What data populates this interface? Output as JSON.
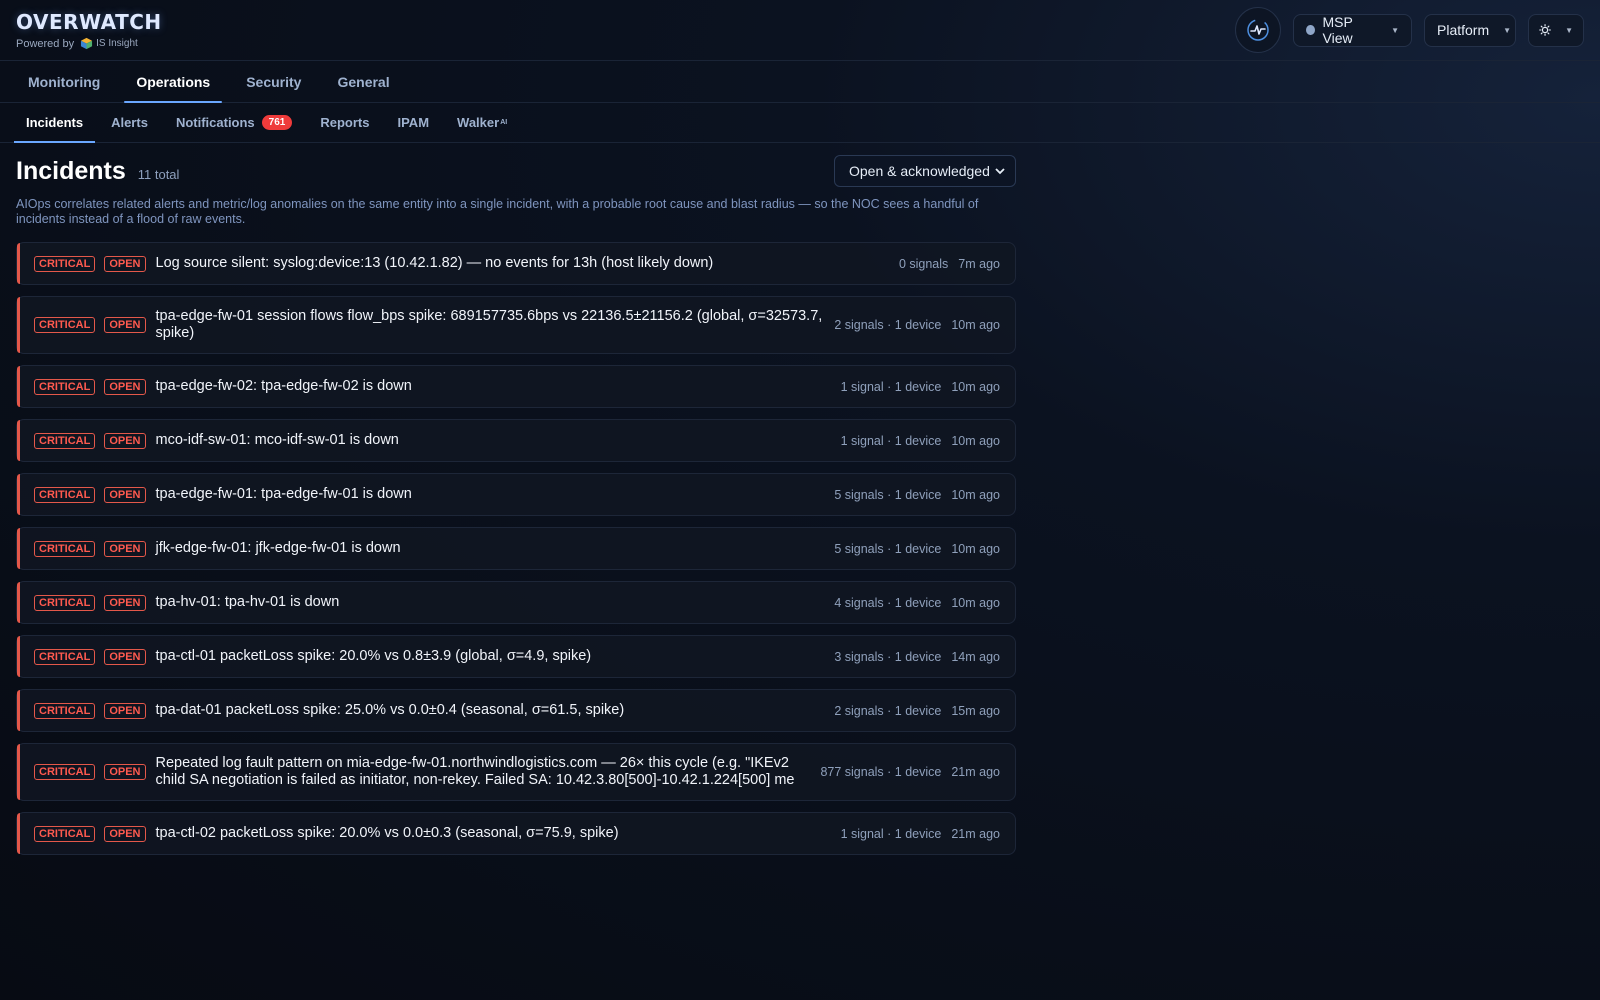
{
  "brand": {
    "title": "OVERWATCH",
    "powered_by": "Powered by",
    "logo_text": "IS Insight"
  },
  "header": {
    "msp_view": "MSP View",
    "platform": "Platform"
  },
  "main_tabs": [
    "Monitoring",
    "Operations",
    "Security",
    "General"
  ],
  "sub_tabs": {
    "incidents": "Incidents",
    "alerts": "Alerts",
    "notifications": "Notifications",
    "notifications_count": "761",
    "reports": "Reports",
    "ipam": "IPAM",
    "walker": "Walker",
    "walker_sup": "AI"
  },
  "page": {
    "title": "Incidents",
    "total": "11 total",
    "filter": "Open & acknowledged",
    "description": "AIOps correlates related alerts and metric/log anomalies on the same entity into a single incident, with a probable root cause and blast radius — so the NOC sees a handful of incidents instead of a flood of raw events."
  },
  "incidents": [
    {
      "severity": "CRITICAL",
      "status": "OPEN",
      "title": "Log source silent: syslog:device:13 (10.42.1.82) — no events for 13h (host likely down)",
      "meta": "0 signals",
      "ago": "7m ago"
    },
    {
      "severity": "CRITICAL",
      "status": "OPEN",
      "title": "tpa-edge-fw-01 session flows flow_bps spike: 689157735.6bps vs 22136.5±21156.2 (global, σ=32573.7, spike)",
      "meta": "2 signals · 1 device",
      "ago": "10m ago"
    },
    {
      "severity": "CRITICAL",
      "status": "OPEN",
      "title": "tpa-edge-fw-02: tpa-edge-fw-02 is down",
      "meta": "1 signal · 1 device",
      "ago": "10m ago"
    },
    {
      "severity": "CRITICAL",
      "status": "OPEN",
      "title": "mco-idf-sw-01: mco-idf-sw-01 is down",
      "meta": "1 signal · 1 device",
      "ago": "10m ago"
    },
    {
      "severity": "CRITICAL",
      "status": "OPEN",
      "title": "tpa-edge-fw-01: tpa-edge-fw-01 is down",
      "meta": "5 signals · 1 device",
      "ago": "10m ago"
    },
    {
      "severity": "CRITICAL",
      "status": "OPEN",
      "title": "jfk-edge-fw-01: jfk-edge-fw-01 is down",
      "meta": "5 signals · 1 device",
      "ago": "10m ago"
    },
    {
      "severity": "CRITICAL",
      "status": "OPEN",
      "title": "tpa-hv-01: tpa-hv-01 is down",
      "meta": "4 signals · 1 device",
      "ago": "10m ago"
    },
    {
      "severity": "CRITICAL",
      "status": "OPEN",
      "title": "tpa-ctl-01 packetLoss spike: 20.0% vs 0.8±3.9 (global, σ=4.9, spike)",
      "meta": "3 signals · 1 device",
      "ago": "14m ago"
    },
    {
      "severity": "CRITICAL",
      "status": "OPEN",
      "title": "tpa-dat-01 packetLoss spike: 25.0% vs 0.0±0.4 (seasonal, σ=61.5, spike)",
      "meta": "2 signals · 1 device",
      "ago": "15m ago"
    },
    {
      "severity": "CRITICAL",
      "status": "OPEN",
      "title": "Repeated log fault pattern on mia-edge-fw-01.northwindlogistics.com — 26× this cycle (e.g. \"IKEv2 child SA negotiation is failed as initiator, non-rekey. Failed SA: 10.42.3.80[500]-10.42.1.224[500] me",
      "meta": "877 signals · 1 device",
      "ago": "21m ago"
    },
    {
      "severity": "CRITICAL",
      "status": "OPEN",
      "title": "tpa-ctl-02 packetLoss spike: 20.0% vs 0.0±0.3 (seasonal, σ=75.9, spike)",
      "meta": "1 signal · 1 device",
      "ago": "21m ago"
    }
  ]
}
